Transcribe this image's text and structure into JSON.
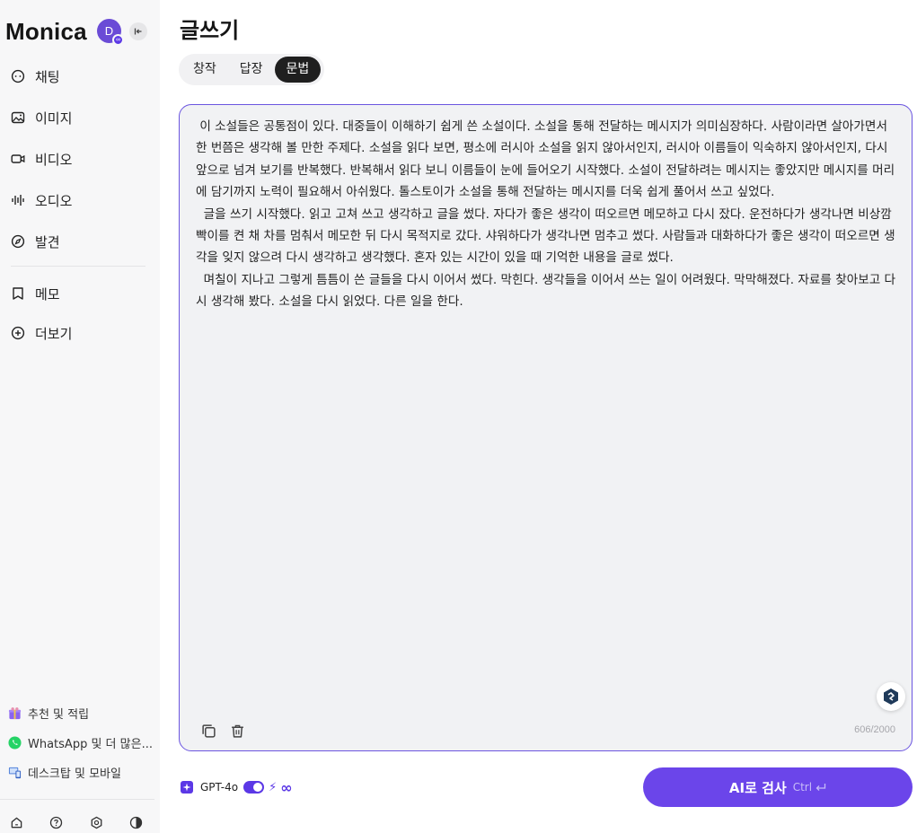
{
  "app": {
    "brand": "Monica",
    "avatar_letter": "D",
    "avatar_badge": "∞"
  },
  "sidebar": {
    "items": [
      {
        "label": "채팅",
        "icon": "chat-bubble-icon"
      },
      {
        "label": "이미지",
        "icon": "image-icon"
      },
      {
        "label": "비디오",
        "icon": "video-icon"
      },
      {
        "label": "오디오",
        "icon": "audio-wave-icon"
      },
      {
        "label": "발견",
        "icon": "compass-icon"
      }
    ],
    "lower_items": [
      {
        "label": "메모",
        "icon": "bookmark-icon"
      },
      {
        "label": "더보기",
        "icon": "plus-circle-icon"
      }
    ],
    "extras": [
      {
        "label": "추천 및 적립",
        "icon": "gift-icon"
      },
      {
        "label": "WhatsApp 및 더 많은...",
        "icon": "whatsapp-icon"
      },
      {
        "label": "데스크탑 및 모바일",
        "icon": "devices-icon"
      }
    ],
    "bottom_icons": [
      "home-icon",
      "help-icon",
      "settings-icon",
      "theme-icon"
    ]
  },
  "main": {
    "title": "글쓰기",
    "tabs": [
      {
        "label": "창작",
        "active": false
      },
      {
        "label": "답장",
        "active": false
      },
      {
        "label": "문법",
        "active": true
      }
    ],
    "editor": {
      "text": " 이 소설들은 공통점이 있다. 대중들이 이해하기 쉽게 쓴 소설이다. 소설을 통해 전달하는 메시지가 의미심장하다. 사람이라면 살아가면서 한 번쯤은 생각해 볼 만한 주제다. 소설을 읽다 보면, 평소에 러시아 소설을 읽지 않아서인지, 러시아 이름들이 익숙하지 않아서인지, 다시 앞으로 넘겨 보기를 반복했다. 반복해서 읽다 보니 이름들이 눈에 들어오기 시작했다. 소설이 전달하려는 메시지는 좋았지만 메시지를 머리에 담기까지 노력이 필요해서 아쉬웠다. 톨스토이가 소설을 통해 전달하는 메시지를 더욱 쉽게 풀어서 쓰고 싶었다.\n  글을 쓰기 시작했다. 읽고 고쳐 쓰고 생각하고 글을 썼다. 자다가 좋은 생각이 떠오르면 메모하고 다시 잤다. 운전하다가 생각나면 비상깜빡이를 켠 채 차를 멈춰서 메모한 뒤 다시 목적지로 갔다. 샤워하다가 생각나면 멈추고 썼다. 사람들과 대화하다가 좋은 생각이 떠오르면 생각을 잊지 않으려 다시 생각하고 생각했다. 혼자 있는 시간이 있을 때 기억한 내용을 글로 썼다.\n  며칠이 지나고 그렇게 틈틈이 쓴 글들을 다시 이어서 썼다. 막힌다. 생각들을 이어서 쓰는 일이 어려웠다. 막막해졌다. 자료를 찾아보고 다시 생각해 봤다. 소설을 다시 읽었다. 다른 일을 한다.",
      "char_count": "606/2000"
    },
    "model": {
      "name": "GPT-4o",
      "enabled": true
    },
    "submit": {
      "label": "AI로 검사",
      "shortcut": "Ctrl"
    }
  },
  "colors": {
    "accent": "#6b45ea",
    "editor_border": "#6b55e0",
    "editor_bg": "#f1f2f4",
    "sidebar_bg": "#f7f7f8"
  }
}
